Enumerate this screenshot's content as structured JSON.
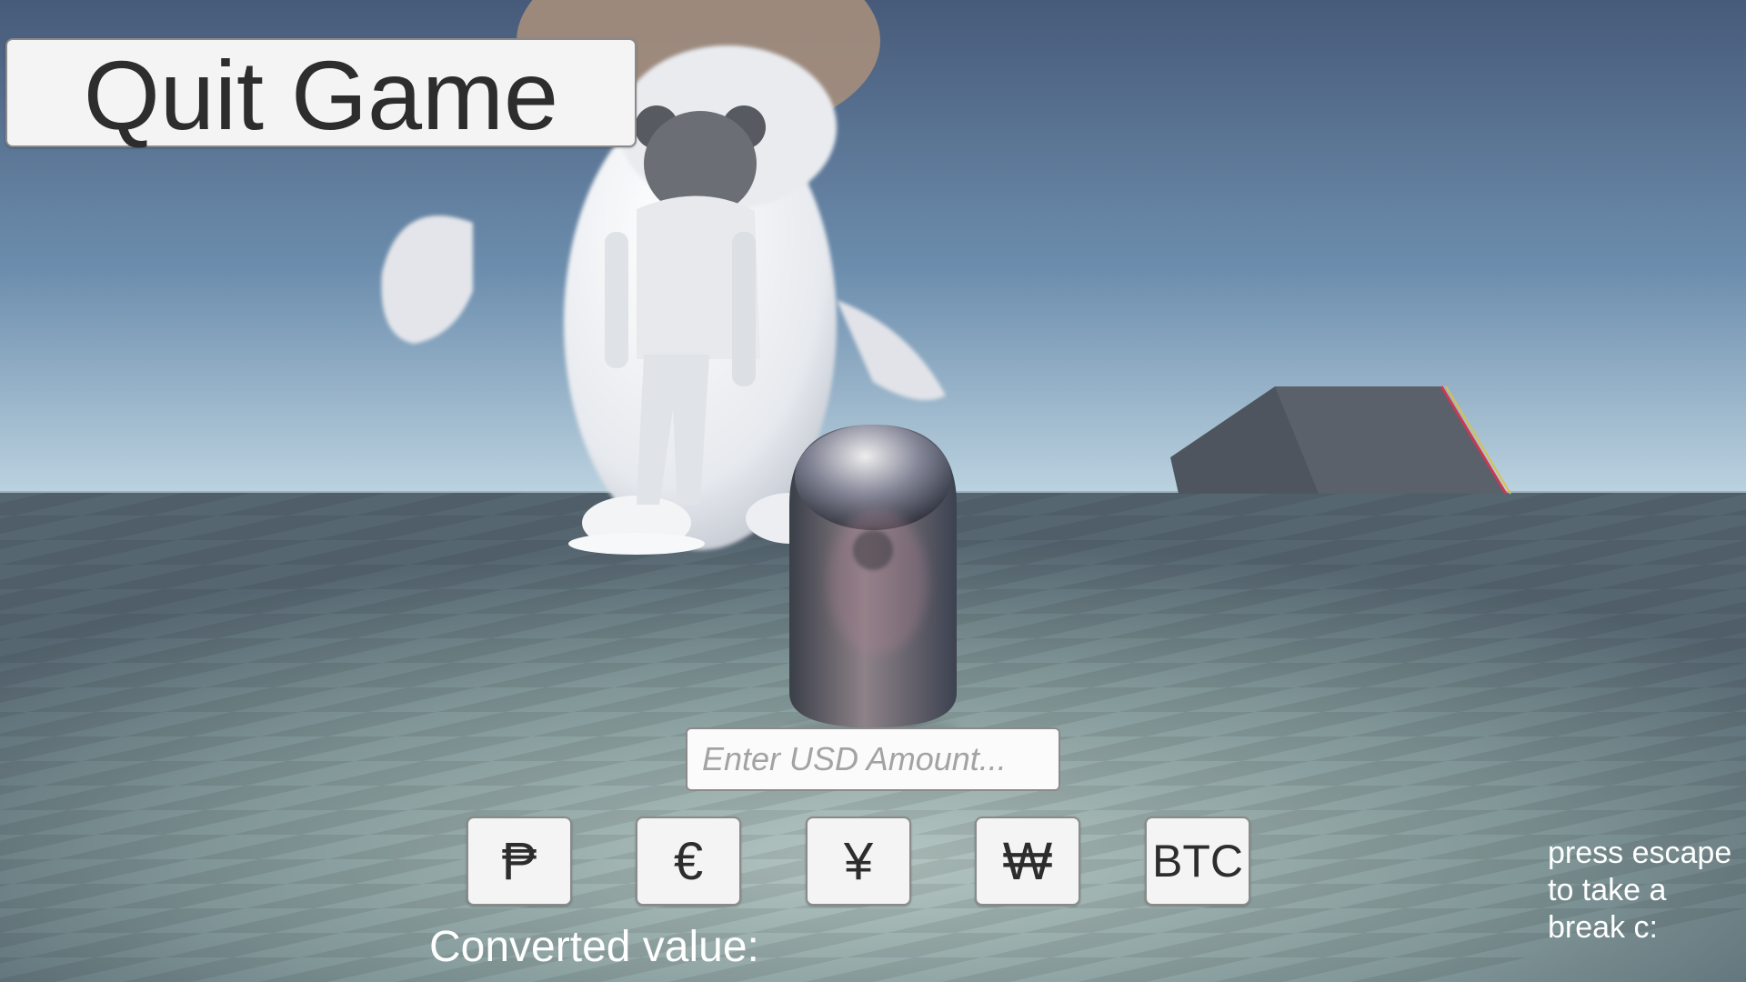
{
  "menu": {
    "quit_label": "Quit Game"
  },
  "converter": {
    "input_placeholder": "Enter USD Amount...",
    "input_value": "",
    "currencies": [
      {
        "label": "₱",
        "icon": "peso-icon"
      },
      {
        "label": "€",
        "icon": "euro-icon"
      },
      {
        "label": "¥",
        "icon": "yen-icon"
      },
      {
        "label": "₩",
        "icon": "won-icon"
      },
      {
        "label": "BTC",
        "icon": "bitcoin-text"
      }
    ],
    "converted_label": "Converted value:"
  },
  "hint": {
    "escape_text": "press escape to take a break c:"
  },
  "colors": {
    "sky_top": "#485b7a",
    "sky_horizon": "#b9d2e0",
    "floor_light": "#8fa5a3",
    "floor_dark": "#5b6c73",
    "button_bg": "#f4f4f4",
    "button_text": "#2d2d2d"
  }
}
